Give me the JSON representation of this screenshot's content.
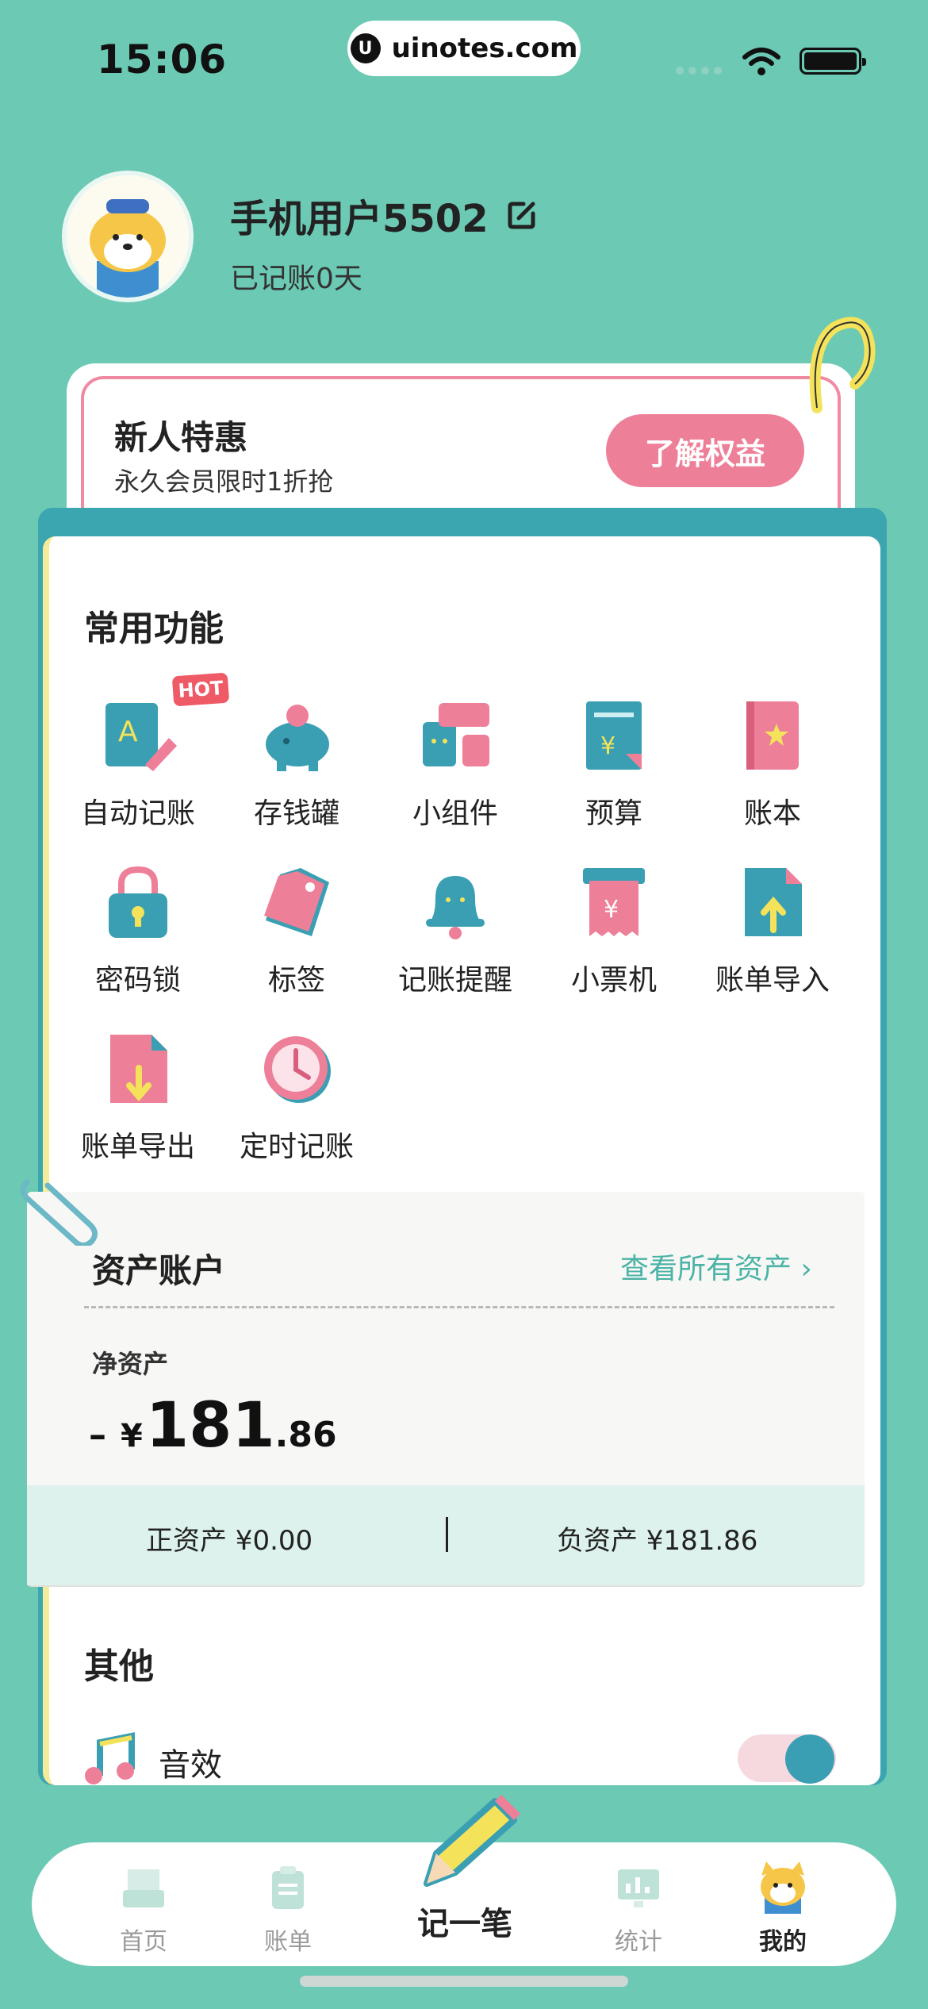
{
  "status_bar": {
    "time": "15:06",
    "url": "uinotes.com",
    "url_logo": "U"
  },
  "profile": {
    "username": "手机用户5502",
    "days_label": "已记账0天"
  },
  "promo": {
    "title": "新人特惠",
    "subtitle": "永久会员限时1折抢",
    "button": "了解权益"
  },
  "common": {
    "title": "常用功能",
    "hot_badge": "HOT",
    "items": [
      {
        "label": "自动记账",
        "icon": "auto-record-icon"
      },
      {
        "label": "存钱罐",
        "icon": "piggy-bank-icon"
      },
      {
        "label": "小组件",
        "icon": "widget-icon"
      },
      {
        "label": "预算",
        "icon": "budget-icon"
      },
      {
        "label": "账本",
        "icon": "ledger-book-icon"
      },
      {
        "label": "密码锁",
        "icon": "padlock-icon"
      },
      {
        "label": "标签",
        "icon": "tag-icon"
      },
      {
        "label": "记账提醒",
        "icon": "bell-icon"
      },
      {
        "label": "小票机",
        "icon": "receipt-icon"
      },
      {
        "label": "账单导入",
        "icon": "import-icon"
      },
      {
        "label": "账单导出",
        "icon": "export-icon"
      },
      {
        "label": "定时记账",
        "icon": "clock-icon"
      }
    ]
  },
  "assets": {
    "title": "资产账户",
    "view_all": "查看所有资产 ›",
    "net_label": "净资产",
    "net_sign": "–",
    "net_currency": "¥",
    "net_int": "181",
    "net_dec": ".86",
    "positive": "正资产 ¥0.00",
    "negative": "负资产 ¥181.86"
  },
  "other": {
    "title": "其他",
    "sound_label": "音效",
    "sound_on": true
  },
  "tabs": {
    "home": "首页",
    "bill": "账单",
    "record": "记一笔",
    "stats": "统计",
    "mine": "我的"
  },
  "colors": {
    "background": "#6cc9b4",
    "accent_pink": "#ee7f98",
    "accent_teal": "#3ba6b0",
    "link": "#4bb3a5"
  }
}
